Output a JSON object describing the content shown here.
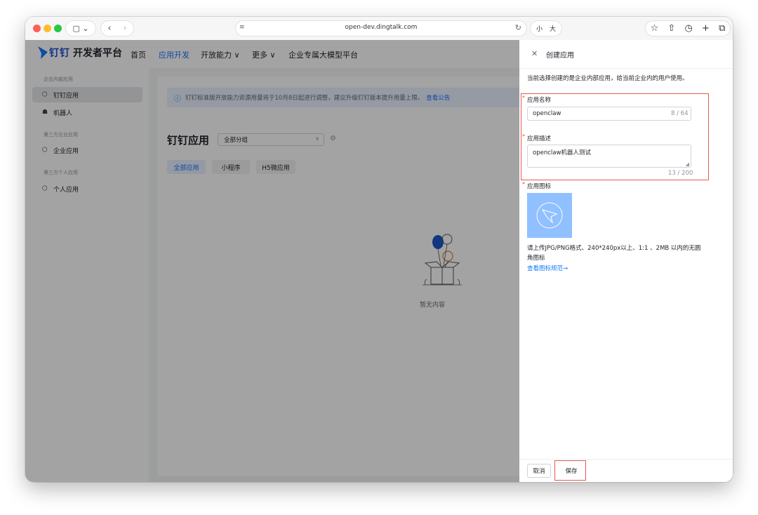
{
  "browser": {
    "url": "open-dev.dingtalk.com",
    "font_small": "小",
    "font_large": "大"
  },
  "topnav": {
    "logo_text": "钉钉",
    "logo_sub": "开发者平台",
    "items": [
      "首页",
      "应用开发",
      "开放能力 ∨",
      "更多 ∨",
      "企业专属大模型平台"
    ],
    "active_index": 1
  },
  "leftnav": {
    "group1": "企业内部应用",
    "item_dingtalk_app": "钉钉应用",
    "item_robot": "机器人",
    "group2": "第三方企业应用",
    "item_enterprise_app": "企业应用",
    "group3": "第三方个人应用",
    "item_personal_app": "个人应用"
  },
  "content": {
    "notice": "钉钉标准版开放能力资源用量将于10月8日起进行调整，建议升级钉钉版本提升用量上限。",
    "notice_link": "查看公告",
    "title": "钉钉应用",
    "group_select": "全部分组",
    "tabs": [
      "全部应用",
      "小程序",
      "H5微应用"
    ],
    "empty_text": "暂无内容"
  },
  "drawer": {
    "title": "创建应用",
    "description": "当前选择创建的是企业内部应用，给当前企业内的用户使用。",
    "name_label": "应用名称",
    "name_value": "openclaw",
    "name_count": "8 / 64",
    "desc_label": "应用描述",
    "desc_value": "openclaw机器人测试",
    "desc_count": "13 / 200",
    "icon_label": "应用图标",
    "icon_hint": "请上传JPG/PNG格式、240*240px以上、1:1 、2MB 以内的无圆角图标",
    "icon_link": "查看图标规范→",
    "cancel": "取消",
    "save": "保存"
  },
  "colors": {
    "accent": "#1677ff",
    "highlight": "#e25b4f"
  }
}
